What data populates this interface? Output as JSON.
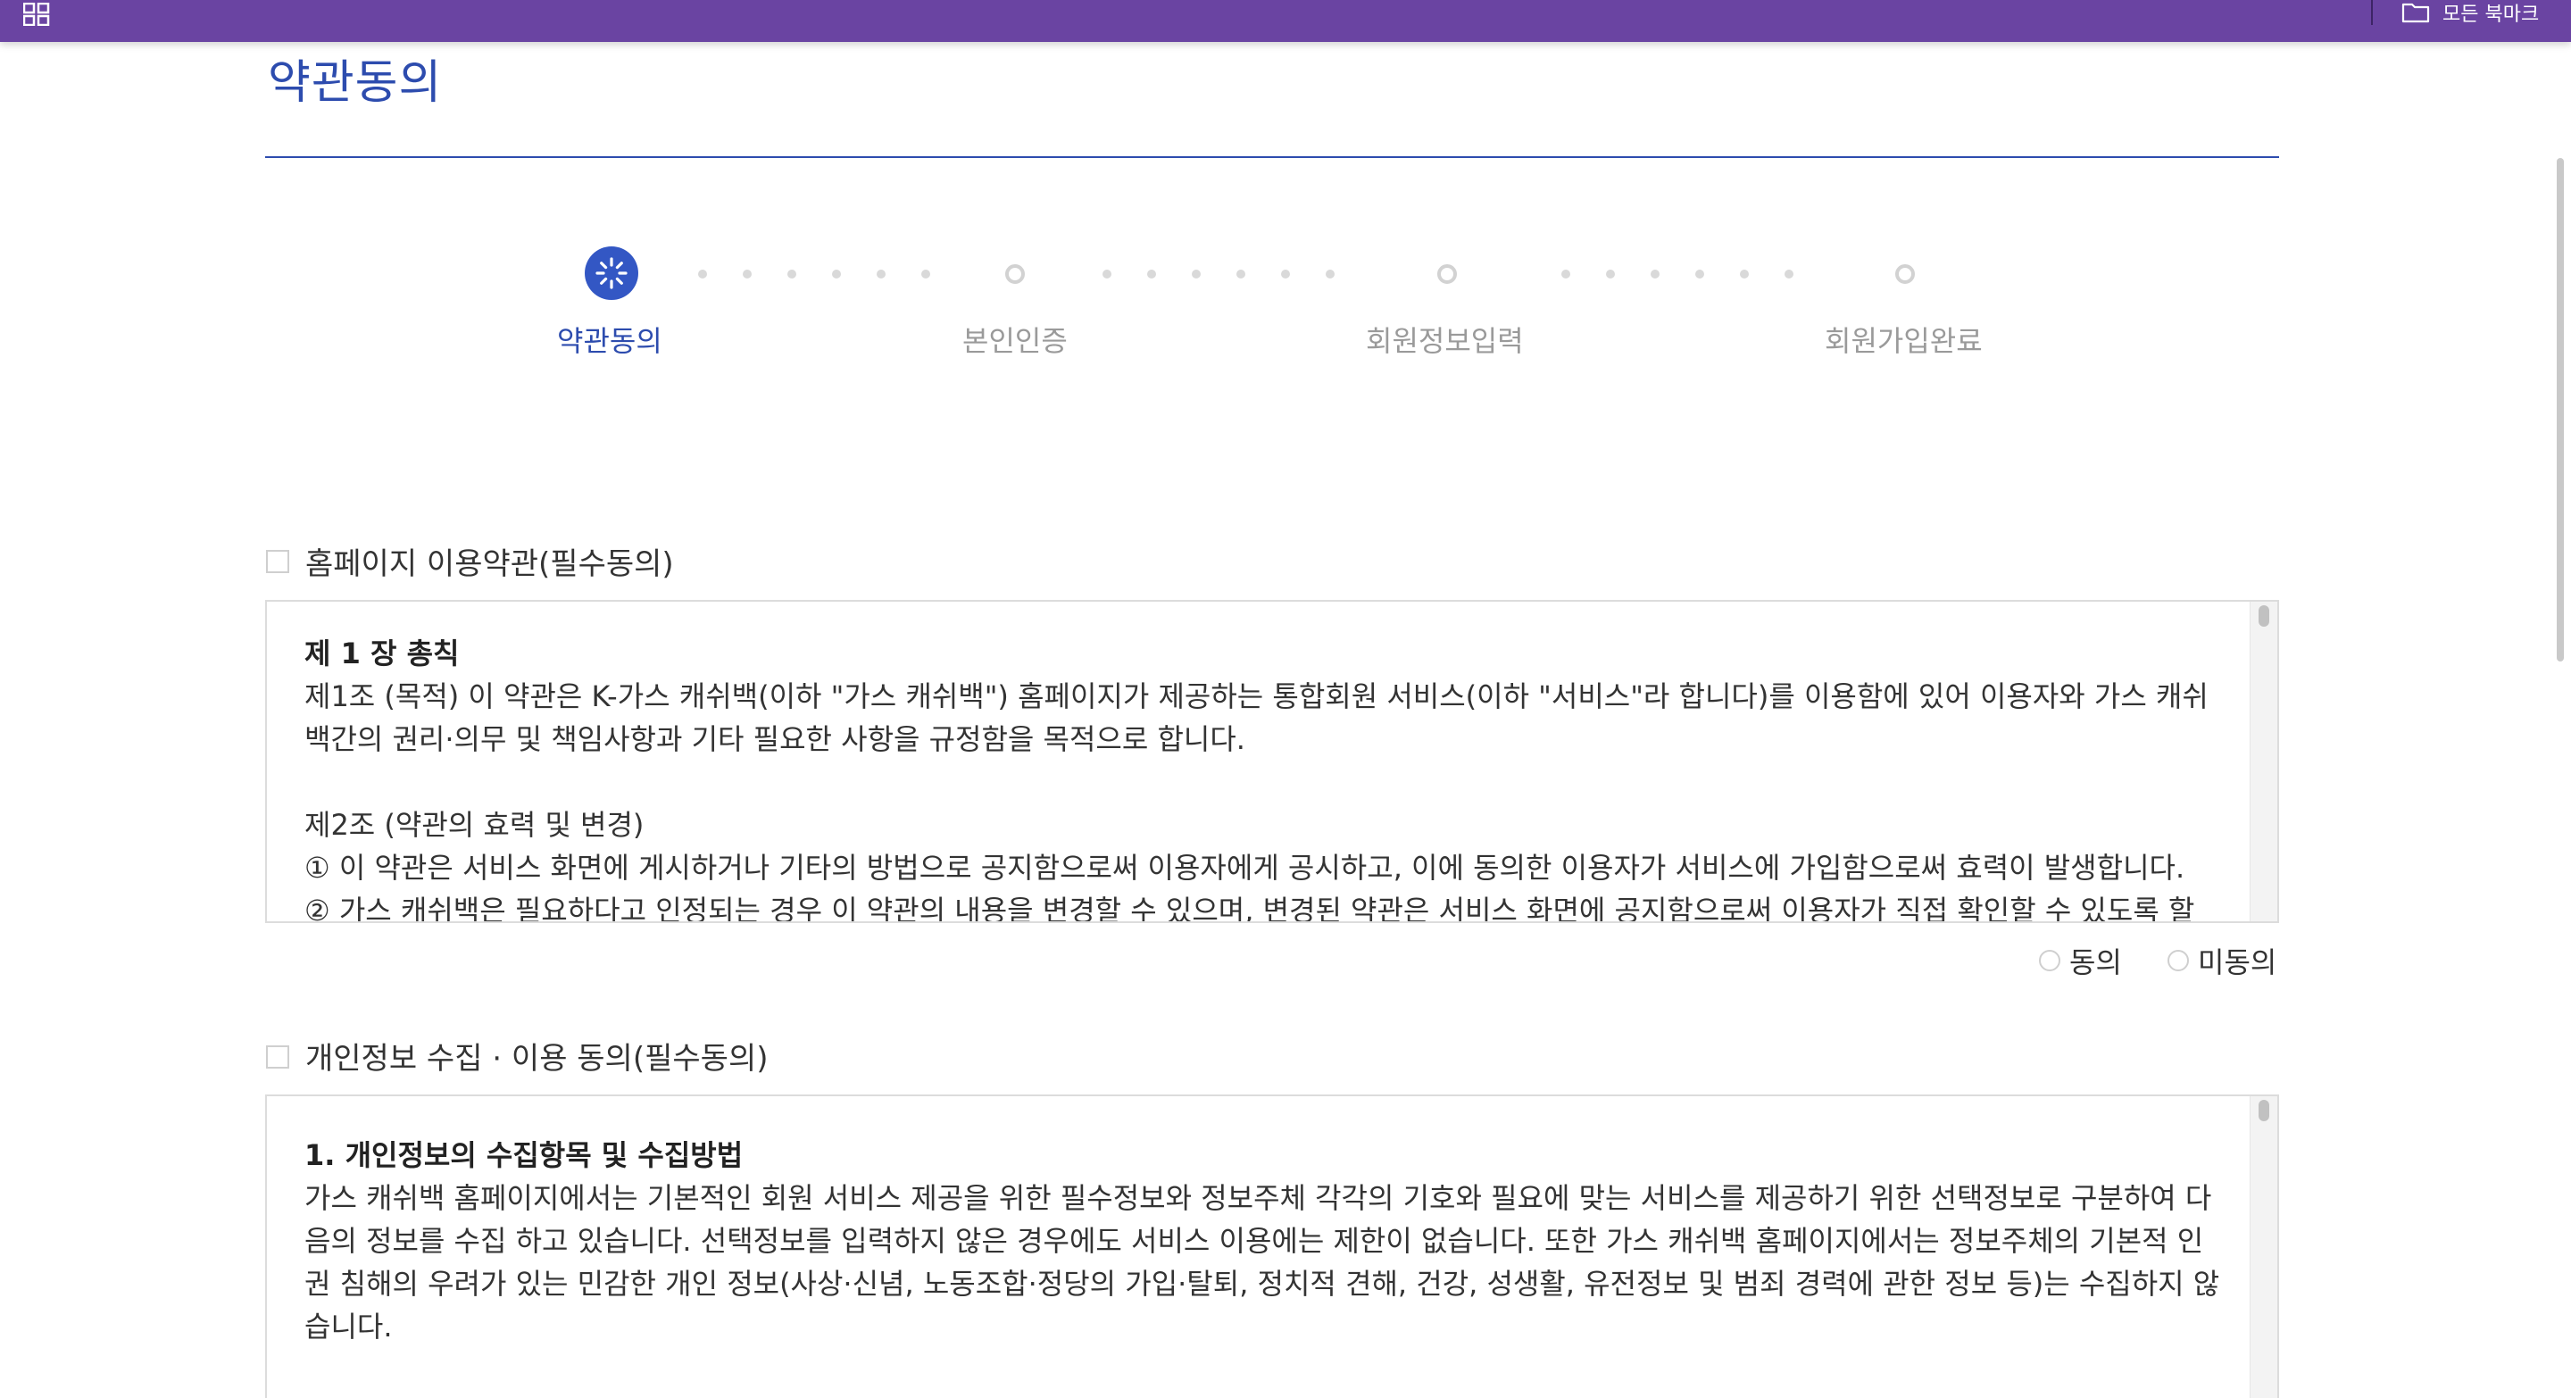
{
  "browser": {
    "bookmarks_label": "모든 북마크"
  },
  "page": {
    "title": "약관동의"
  },
  "stepper": {
    "steps": [
      {
        "label": "약관동의",
        "state": "current"
      },
      {
        "label": "본인인증",
        "state": "pending"
      },
      {
        "label": "회원정보입력",
        "state": "pending"
      },
      {
        "label": "회원가입완료",
        "state": "pending"
      }
    ]
  },
  "terms": {
    "title": "홈페이지 이용약관(필수동의)",
    "heading": "제 1 장 총칙",
    "article1": "제1조 (목적) 이 약관은 K-가스 캐쉬백(이하 \"가스 캐쉬백\") 홈페이지가 제공하는 통합회원 서비스(이하 \"서비스\"라 합니다)를 이용함에 있어 이용자와 가스 캐쉬백간의 권리·의무 및 책임사항과 기타 필요한 사항을 규정함을 목적으로 합니다.",
    "article2_title": "제2조 (약관의 효력 및 변경)",
    "article2_p1": "① 이 약관은 서비스 화면에 게시하거나 기타의 방법으로 공지함으로써 이용자에게 공시하고, 이에 동의한 이용자가 서비스에 가입함으로써 효력이 발생합니다.",
    "article2_p2": "② 가스 캐쉬백은 필요하다고 인정되는 경우 이 약관의 내용을 변경할 수 있으며, 변경된 약관은 서비스 화면에 공지함으로써 이용자가 직접 확인할 수 있도록 할",
    "agree_label": "동의",
    "disagree_label": "미동의"
  },
  "privacy": {
    "title": "개인정보 수집 · 이용 동의(필수동의)",
    "heading": "1. 개인정보의 수집항목 및 수집방법",
    "body": "가스 캐쉬백 홈페이지에서는 기본적인 회원 서비스 제공을 위한 필수정보와 정보주체 각각의 기호와 필요에 맞는 서비스를 제공하기 위한 선택정보로 구분하여 다음의 정보를 수집 하고 있습니다. 선택정보를 입력하지 않은 경우에도 서비스 이용에는 제한이 없습니다. 또한 가스 캐쉬백 홈페이지에서는 정보주체의 기본적 인권 침해의 우려가 있는 민감한 개인 정보(사상·신념, 노동조합·정당의 가입·탈퇴, 정치적 견해, 건강, 성생활, 유전정보 및 범죄 경력에 관한 정보 등)는 수집하지 않습니다."
  },
  "colors": {
    "topbar": "#6a44a2",
    "accent": "#2d4cae",
    "step_active": "#3357c4",
    "inactive": "#9a9a9a"
  },
  "icons": {
    "apps": "apps-grid-icon",
    "bookmarks": "folder-icon",
    "current_step": "loading-spinner-icon"
  }
}
